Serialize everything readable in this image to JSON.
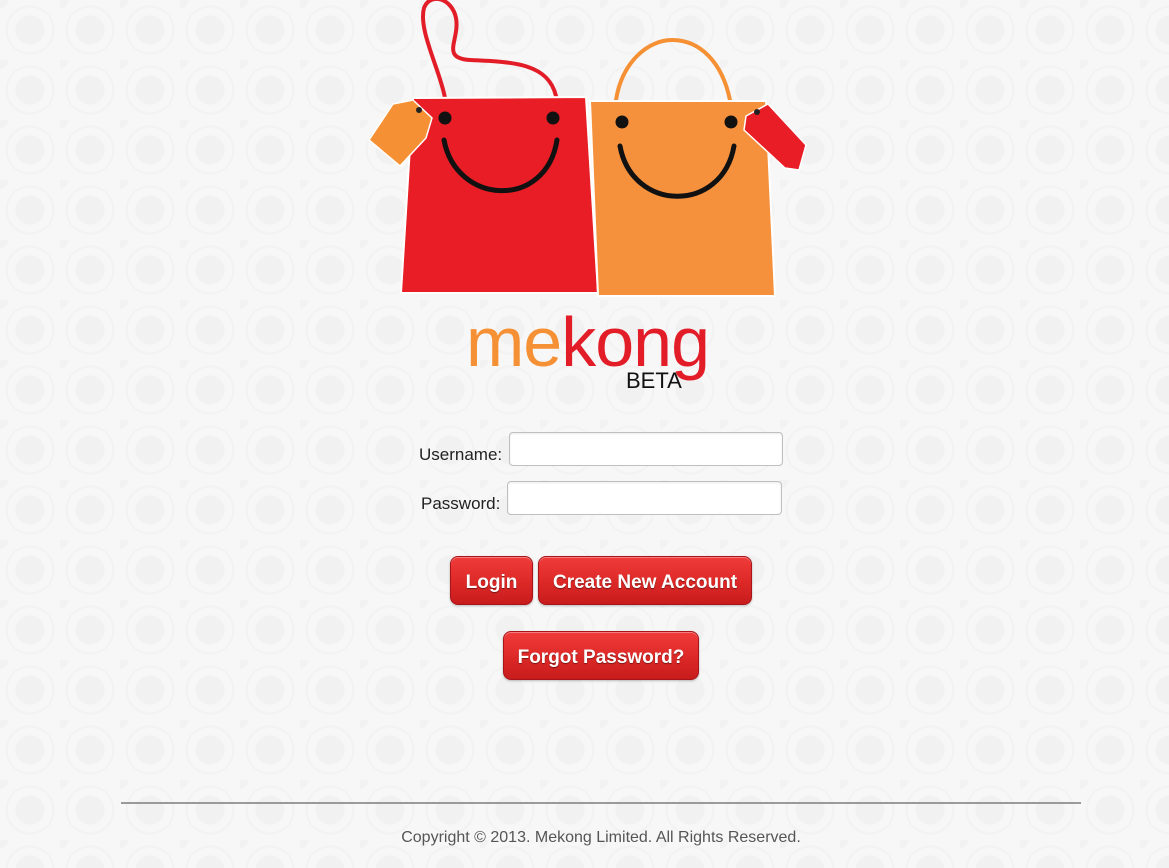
{
  "brand": {
    "name_part1": "me",
    "name_part2": "kong",
    "tag": "BETA"
  },
  "form": {
    "username_label": "Username:",
    "username_value": "",
    "password_label": "Password:",
    "password_value": ""
  },
  "buttons": {
    "login": "Login",
    "create_account": "Create New Account",
    "forgot_password": "Forgot Password?"
  },
  "footer": {
    "copyright": "Copyright © 2013. Mekong Limited. All Rights Reserved."
  },
  "colors": {
    "brand_orange": "#f59134",
    "brand_red": "#e21d28",
    "button_red": "#de2a28",
    "background": "#f7f7f7"
  },
  "icons": {
    "logo": "smiling-shopping-bags-logo"
  }
}
